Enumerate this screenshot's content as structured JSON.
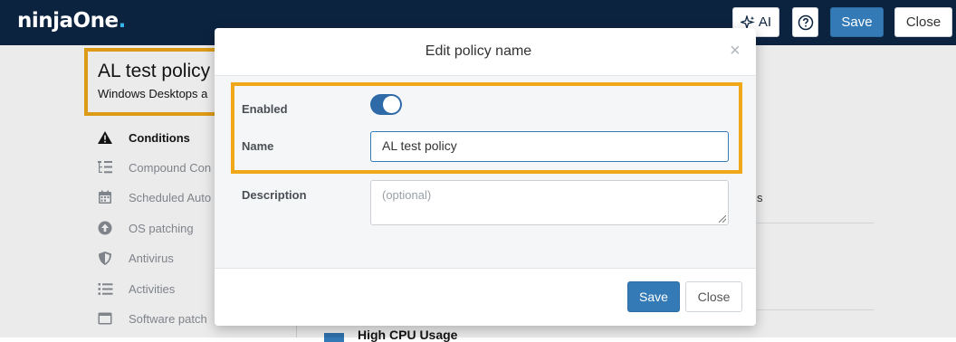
{
  "app": {
    "logo_main": "ninjaOne",
    "logo_dot": "."
  },
  "toolbar": {
    "ai_label": "AI",
    "save_label": "Save",
    "close_label": "Close"
  },
  "policy": {
    "title": "AL test policy",
    "subtitle": "Windows Desktops a"
  },
  "sidebar": {
    "items": [
      {
        "label": "Conditions",
        "icon": "warning-icon",
        "active": true
      },
      {
        "label": "Compound Con",
        "icon": "tree-list-icon",
        "active": false
      },
      {
        "label": "Scheduled Auto",
        "icon": "calendar-icon",
        "active": false
      },
      {
        "label": "OS patching",
        "icon": "arrow-up-circle-icon",
        "active": false
      },
      {
        "label": "Antivirus",
        "icon": "shield-icon",
        "active": false
      },
      {
        "label": "Activities",
        "icon": "list-icon",
        "active": false
      },
      {
        "label": "Software patch",
        "icon": "window-icon",
        "active": false
      }
    ]
  },
  "background": {
    "fragment": "s",
    "high_cpu": "High CPU Usage"
  },
  "modal": {
    "title": "Edit policy name",
    "close_symbol": "×",
    "enabled_label": "Enabled",
    "enabled": true,
    "name_label": "Name",
    "name_value": "AL test policy",
    "description_label": "Description",
    "description_placeholder": "(optional)",
    "save_label": "Save",
    "close_label": "Close"
  },
  "colors": {
    "topbar": "#0c2340",
    "accent": "#337ab7",
    "highlight": "#f0a81a",
    "logo_dot": "#36b3e6"
  }
}
